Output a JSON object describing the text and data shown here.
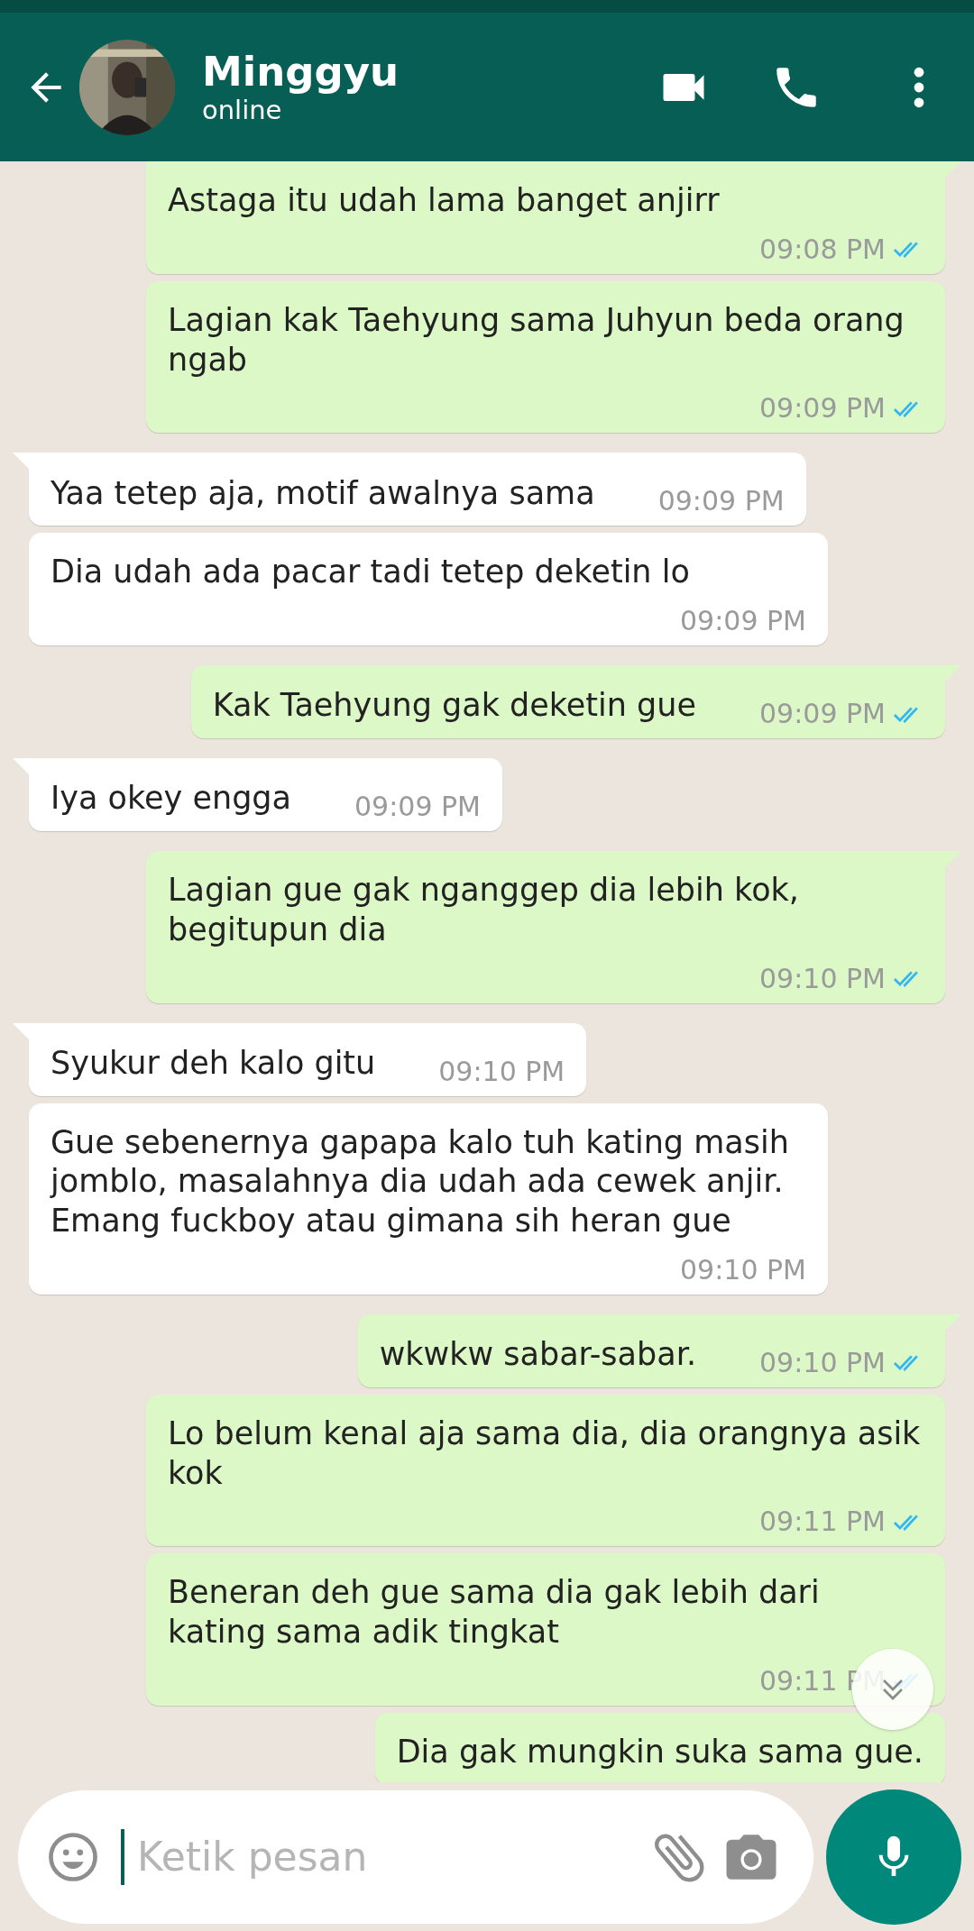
{
  "header": {
    "name": "Minggyu",
    "status": "online"
  },
  "messages": [
    {
      "kind": "out",
      "text": "Astaga itu udah lama banget anjirr",
      "time": "09:08 PM",
      "read": true
    },
    {
      "kind": "out",
      "text": "Lagian kak Taehyung sama Juhyun beda orang ngab",
      "time": "09:09 PM",
      "read": true
    },
    {
      "kind": "in",
      "text": "Yaa tetep aja, motif awalnya sama",
      "time": "09:09 PM"
    },
    {
      "kind": "in",
      "text": "Dia udah ada pacar tadi tetep deketin lo",
      "time": "09:09 PM"
    },
    {
      "kind": "out",
      "text": "Kak Taehyung gak deketin gue",
      "time": "09:09 PM",
      "read": true
    },
    {
      "kind": "in",
      "text": "Iya okey engga",
      "time": "09:09 PM"
    },
    {
      "kind": "out",
      "text": "Lagian gue gak nganggep dia lebih kok, begitupun dia",
      "time": "09:10 PM",
      "read": true
    },
    {
      "kind": "in",
      "text": "Syukur deh kalo gitu",
      "time": "09:10 PM"
    },
    {
      "kind": "in",
      "text": "Gue sebenernya gapapa kalo tuh kating masih jomblo, masalahnya dia udah ada cewek anjir. Emang fuckboy atau gimana sih heran gue",
      "time": "09:10 PM"
    },
    {
      "kind": "out",
      "text": "wkwkw sabar-sabar.",
      "time": "09:10 PM",
      "read": true
    },
    {
      "kind": "out",
      "text": "Lo belum kenal aja sama dia, dia orangnya asik kok",
      "time": "09:11 PM",
      "read": true
    },
    {
      "kind": "out",
      "text": "Beneran deh gue sama dia gak lebih dari kating sama adik tingkat",
      "time": "09:11 PM",
      "read": true
    },
    {
      "kind": "out",
      "text": "Dia gak mungkin suka sama gue."
    }
  ],
  "composer": {
    "placeholder": "Ketik pesan"
  }
}
